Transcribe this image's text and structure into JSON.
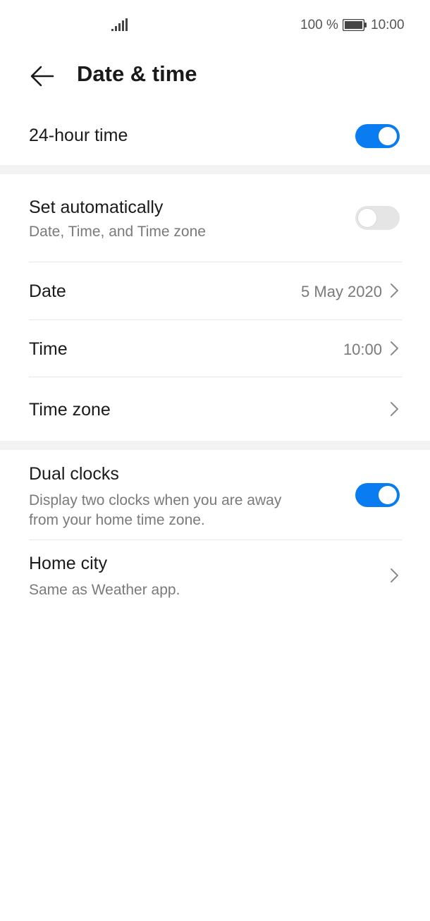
{
  "status_bar": {
    "battery_percent": "100 %",
    "time": "10:00",
    "icons": [
      "signal-icon",
      "battery-icon"
    ]
  },
  "app_bar": {
    "title": "Date & time",
    "back_icon": "arrow-left-icon"
  },
  "settings": {
    "hour24": {
      "label": "24-hour time",
      "enabled": true
    },
    "auto": {
      "label": "Set automatically",
      "sub": "Date, Time, and Time zone",
      "enabled": false
    },
    "date": {
      "label": "Date",
      "value": "5 May 2020"
    },
    "time": {
      "label": "Time",
      "value": "10:00"
    },
    "timezone": {
      "label": "Time zone"
    },
    "dual": {
      "label": "Dual clocks",
      "sub1": "Display two clocks when you are away",
      "sub2": "from your home time zone.",
      "enabled": true
    },
    "home_city": {
      "label": "Home city",
      "sub": "Same as Weather app."
    }
  },
  "colors": {
    "accent": "#0a7cf2",
    "toggle_off": "#e5e5e5",
    "section_band": "#f3f3f3",
    "secondary_text": "#7a7a7a"
  }
}
